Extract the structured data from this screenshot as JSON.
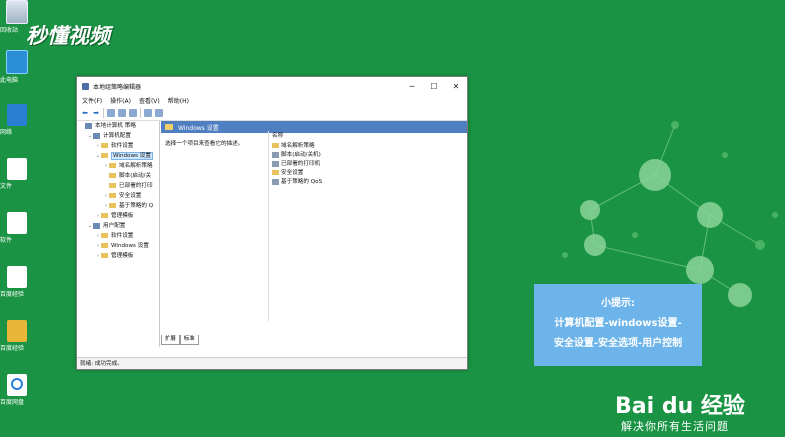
{
  "brand": "秒懂视频",
  "desktop_icons": [
    {
      "label": "回收站",
      "icon": "recycle-bin-icon"
    },
    {
      "label": "此电脑",
      "icon": "computer-icon"
    },
    {
      "label": "网络",
      "icon": "network-icon"
    },
    {
      "label": "文件",
      "icon": "file-icon"
    },
    {
      "label": "软件",
      "icon": "file-icon"
    },
    {
      "label": "百度经验",
      "icon": "file-icon"
    },
    {
      "label": "百度经验",
      "icon": "folder-icon"
    },
    {
      "label": "百度网盘",
      "icon": "baidu-netdisk-icon"
    }
  ],
  "window": {
    "title": "本地组策略编辑器",
    "menu": [
      "文件(F)",
      "操作(A)",
      "查看(V)",
      "帮助(H)"
    ],
    "tree": [
      {
        "label": "本地计算机 策略",
        "level": 0,
        "expander": "",
        "icon": "computer"
      },
      {
        "label": "计算机配置",
        "level": 1,
        "expander": "⌄",
        "icon": "computer"
      },
      {
        "label": "软件设置",
        "level": 2,
        "expander": "›",
        "icon": "folder"
      },
      {
        "label": "Windows 设置",
        "level": 2,
        "expander": "⌄",
        "icon": "folder",
        "selected": true
      },
      {
        "label": "域名解析策略",
        "level": 3,
        "expander": "›",
        "icon": "folder"
      },
      {
        "label": "脚本(启动/关",
        "level": 3,
        "expander": "",
        "icon": "folder"
      },
      {
        "label": "已部署的打印",
        "level": 3,
        "expander": "",
        "icon": "folder"
      },
      {
        "label": "安全设置",
        "level": 3,
        "expander": "›",
        "icon": "folder"
      },
      {
        "label": "基于策略的 Q",
        "level": 3,
        "expander": "›",
        "icon": "folder"
      },
      {
        "label": "管理模板",
        "level": 2,
        "expander": "›",
        "icon": "folder"
      },
      {
        "label": "用户配置",
        "level": 1,
        "expander": "⌄",
        "icon": "computer"
      },
      {
        "label": "软件设置",
        "level": 2,
        "expander": "›",
        "icon": "folder"
      },
      {
        "label": "Windows 设置",
        "level": 2,
        "expander": "›",
        "icon": "folder"
      },
      {
        "label": "管理模板",
        "level": 2,
        "expander": "›",
        "icon": "folder"
      }
    ],
    "right_header": "Windows 设置",
    "description": "选择一个项目来查看它的描述。",
    "column_name": "名称",
    "items": [
      "域名解析策略",
      "脚本(启动/关机)",
      "已部署的打印机",
      "安全设置",
      "基于策略的 QoS"
    ],
    "tabs": [
      "扩展",
      "标准"
    ],
    "status": "就绪: 成功完成。"
  },
  "tip": {
    "title": "小提示:",
    "line1": "计算机配置-windows设置-",
    "line2": "安全设置-安全选项-用户控制"
  },
  "baidu": {
    "logo": "Bai du 经验",
    "slogan": "解决你所有生活问题"
  }
}
